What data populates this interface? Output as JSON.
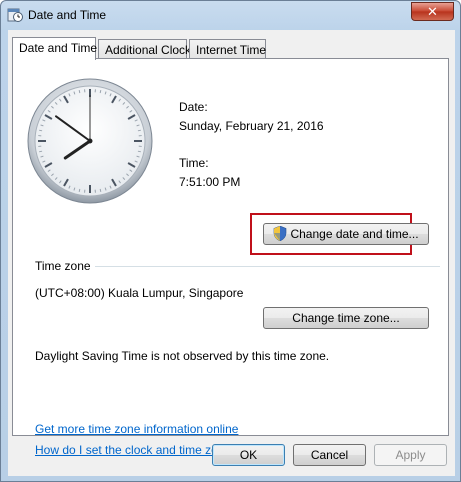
{
  "window": {
    "title": "Date and Time",
    "close_symbol": "✕",
    "icon": "clock-calendar-icon"
  },
  "tabs": [
    {
      "label": "Date and Time",
      "active": true
    },
    {
      "label": "Additional Clocks",
      "active": false
    },
    {
      "label": "Internet Time",
      "active": false
    }
  ],
  "datetime": {
    "date_label": "Date:",
    "date_value": "Sunday, February 21, 2016",
    "time_label": "Time:",
    "time_value": "7:51:00 PM",
    "change_button": "Change date and time..."
  },
  "timezone": {
    "section_label": "Time zone",
    "value": "(UTC+08:00) Kuala Lumpur, Singapore",
    "change_button": "Change time zone...",
    "dst_note": "Daylight Saving Time is not observed by this time zone."
  },
  "links": {
    "more_info": "Get more time zone information online",
    "how_to": "How do I set the clock and time zone?"
  },
  "footer": {
    "ok": "OK",
    "cancel": "Cancel",
    "apply": "Apply"
  },
  "colors": {
    "highlight_border": "#c0101a",
    "link": "#0066cc"
  }
}
